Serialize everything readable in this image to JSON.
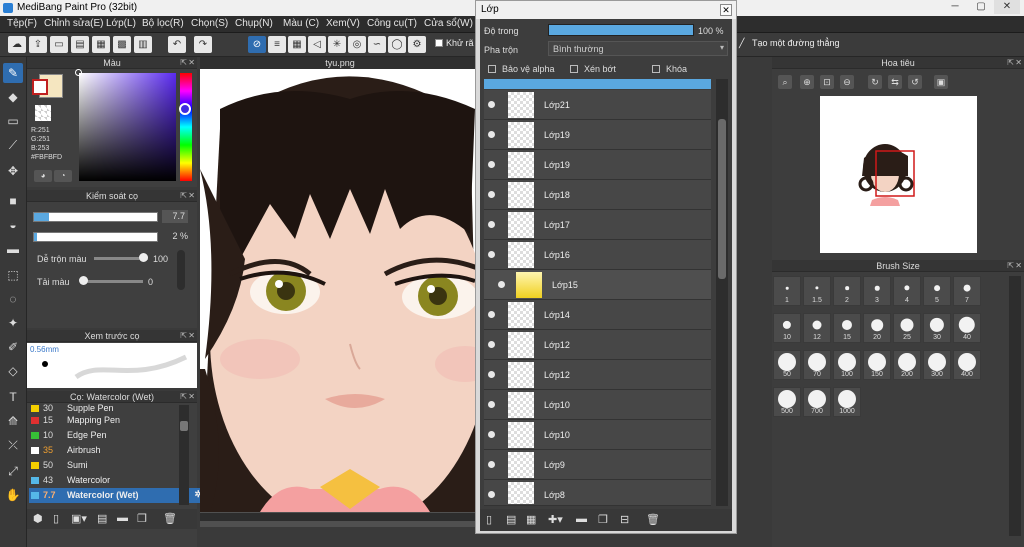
{
  "window": {
    "title": "MediBang Paint Pro (32bit)",
    "min": "─",
    "max": "▢",
    "close": "✕"
  },
  "menu": [
    "Tệp(F)",
    "Chỉnh sửa(E)",
    "Lớp(L)",
    "Bộ lọc(R)",
    "Chọn(S)",
    "Chụp(N)",
    "Màu (C)",
    "Xem(V)",
    "Công cụ(T)",
    "Cửa sổ(W)"
  ],
  "toolbar": {
    "antialias_label": "Khử rã",
    "line_hint": "Tạo một đường thẳng"
  },
  "color_panel": {
    "title": "Màu",
    "r": "R:251",
    "g": "G:251",
    "b": "B:253",
    "hex": "#FBFBFD",
    "primary": "#ffffff",
    "secondary": "#f5e6c0"
  },
  "brush_control": {
    "title": "Kiểm soát cọ",
    "size_value": "7.7",
    "opacity_value": "2 %",
    "blend_label": "Dễ trộn màu",
    "blend_value": "100",
    "reload_label": "Tải màu",
    "reload_value": "0"
  },
  "preview": {
    "title": "Xem trước cọ",
    "size": "0.56mm"
  },
  "brush_list": {
    "title": "Cọ: Watercolor (Wet)",
    "items": [
      {
        "num": "30",
        "name": "Supple Pen",
        "color": "#f5d000"
      },
      {
        "num": "15",
        "name": "Mapping Pen",
        "color": "#e03030"
      },
      {
        "num": "10",
        "name": "Edge Pen",
        "color": "#36c036"
      },
      {
        "num": "35",
        "name": "Airbrush",
        "color": "#f0a030"
      },
      {
        "num": "50",
        "name": "Sumi",
        "color": "#f5d000"
      },
      {
        "num": "43",
        "name": "Watercolor",
        "color": "#55b8e8"
      },
      {
        "num": "7.7",
        "name": "Watercolor (Wet)",
        "color": "#55b8e8"
      }
    ]
  },
  "canvas": {
    "title": "tyu.png"
  },
  "layer_window": {
    "title": "Lớp",
    "opacity_label": "Độ trong",
    "opacity_value": "100 %",
    "blend_label": "Pha trộn",
    "blend_value": "Bình thường",
    "protect_alpha": "Bảo vệ alpha",
    "clipping": "Xén bớt",
    "lock": "Khóa",
    "layers": [
      "Lớp21",
      "Lớp19",
      "Lớp19",
      "Lớp18",
      "Lớp17",
      "Lớp16",
      "Lớp15",
      "Lớp14",
      "Lớp12",
      "Lớp12",
      "Lớp10",
      "Lớp10",
      "Lớp9",
      "Lớp8"
    ]
  },
  "navigator": {
    "title": "Hoa tiêu"
  },
  "brush_size": {
    "title": "Brush Size",
    "sizes": [
      "1",
      "1.5",
      "2",
      "3",
      "4",
      "5",
      "7",
      "10",
      "12",
      "15",
      "20",
      "25",
      "30",
      "40",
      "50",
      "70",
      "100",
      "150",
      "200",
      "300",
      "400",
      "500",
      "700",
      "1000"
    ]
  }
}
